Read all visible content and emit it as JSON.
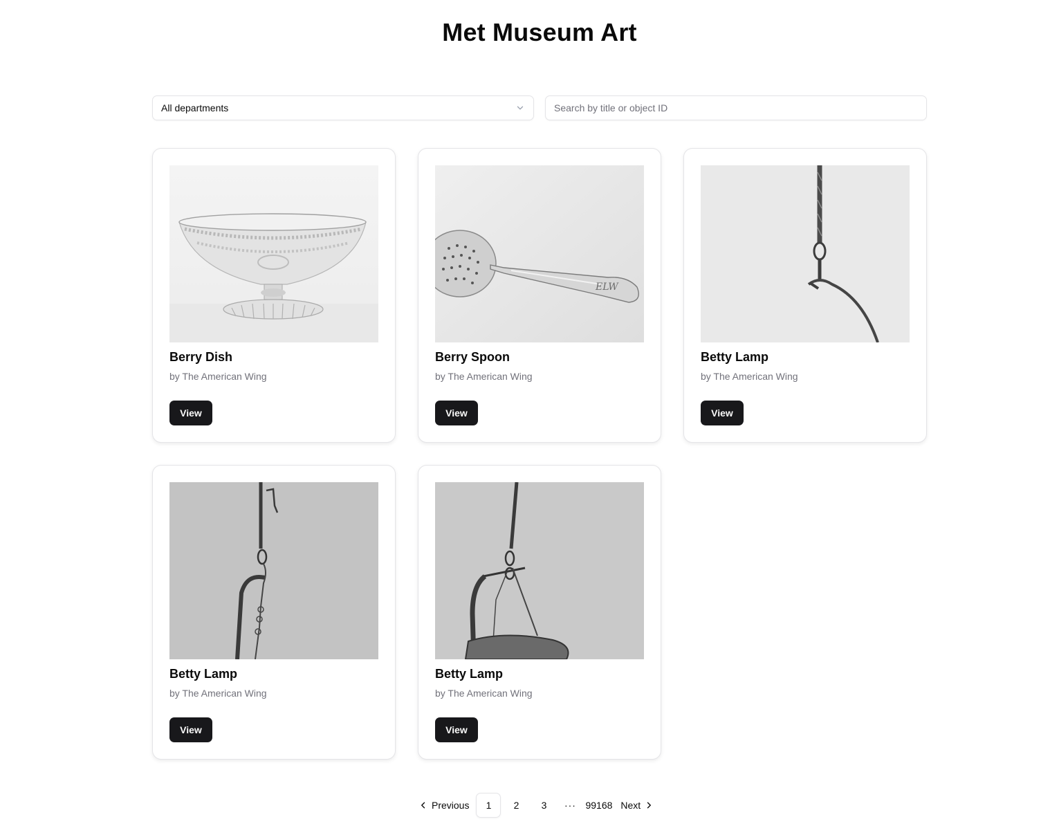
{
  "page": {
    "title": "Met Museum Art"
  },
  "filters": {
    "department_selected": "All departments",
    "search_placeholder": "Search by title or object ID"
  },
  "artworks": [
    {
      "title": "Berry Dish",
      "subtitle": "by The American Wing",
      "button": "View"
    },
    {
      "title": "Berry Spoon",
      "subtitle": "by The American Wing",
      "button": "View"
    },
    {
      "title": "Betty Lamp",
      "subtitle": "by The American Wing",
      "button": "View"
    },
    {
      "title": "Betty Lamp",
      "subtitle": "by The American Wing",
      "button": "View"
    },
    {
      "title": "Betty Lamp",
      "subtitle": "by The American Wing",
      "button": "View"
    }
  ],
  "pagination": {
    "previous_label": "Previous",
    "next_label": "Next",
    "pages": [
      "1",
      "2",
      "3"
    ],
    "current_page": "1",
    "ellipsis": "···",
    "last_page": "99168"
  }
}
